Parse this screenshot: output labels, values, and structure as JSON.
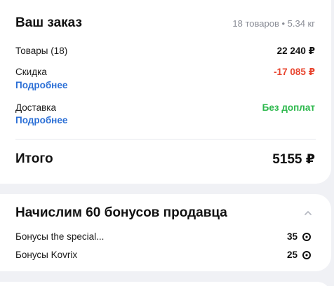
{
  "order": {
    "title": "Ваш заказ",
    "meta": "18 товаров • 5.34 кг",
    "items_label": "Товары (18)",
    "items_value": "22 240 ₽",
    "discount_label": "Скидка",
    "discount_link": "Подробнее",
    "discount_value": "-17 085 ₽",
    "delivery_label": "Доставка",
    "delivery_link": "Подробнее",
    "delivery_value": "Без доплат",
    "total_label": "Итого",
    "total_value": "5155 ₽"
  },
  "bonus": {
    "title": "Начислим 60 бонусов продавца",
    "rows": [
      {
        "label": "Бонусы the special...",
        "value": "35"
      },
      {
        "label": "Бонусы Kovrix",
        "value": "25"
      }
    ]
  },
  "colors": {
    "accent_link": "#2b6fd6",
    "discount_red": "#e8442e",
    "delivery_green": "#2cb84c"
  },
  "icons": [
    "chevron-up-icon",
    "bonus-coin-icon"
  ]
}
